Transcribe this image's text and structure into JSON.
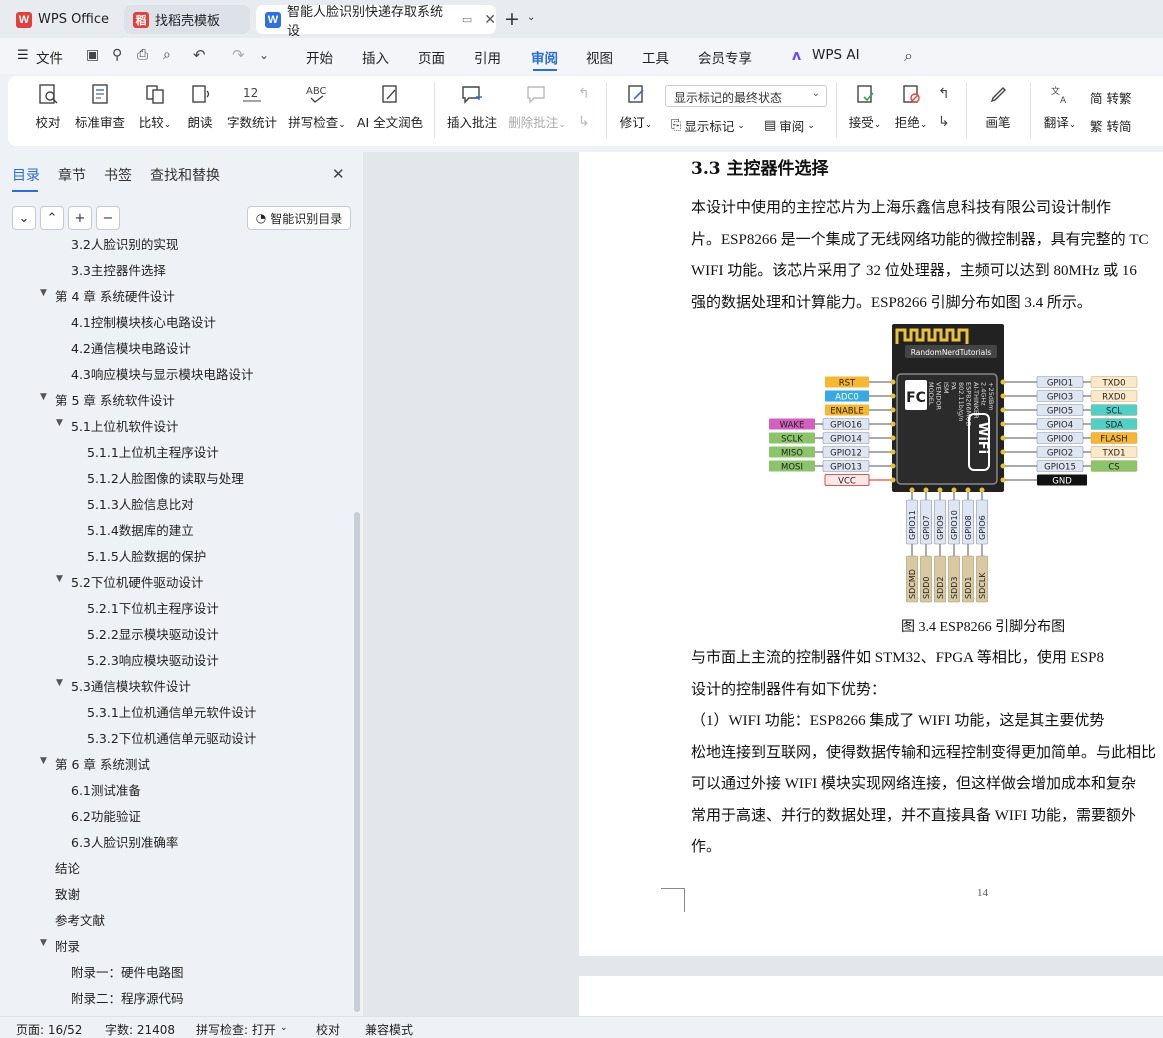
{
  "tabs": [
    {
      "label": "WPS Office",
      "icon": "W"
    },
    {
      "label": "找稻壳模板",
      "icon": "稻"
    },
    {
      "label": "智能人脸识别快递存取系统设",
      "icon": "W"
    }
  ],
  "menu": [
    "文件",
    "开始",
    "插入",
    "页面",
    "引用",
    "审阅",
    "视图",
    "工具",
    "会员专享",
    "WPS AI"
  ],
  "ribbon": {
    "buttons": [
      "校对",
      "标准审查",
      "比较",
      "朗读",
      "字数统计",
      "拼写检查",
      "AI 全文润色",
      "插入批注",
      "删除批注",
      "修订"
    ],
    "markup_select": "显示标记的最终状态",
    "show_markup": "显示标记",
    "review_pane": "审阅",
    "accept": "接受",
    "reject": "拒绝",
    "pen": "画笔",
    "translate": "翻译",
    "to_traditional": "简 转繁",
    "to_simplified": "繁 转简"
  },
  "nav": {
    "tabs": [
      "目录",
      "章节",
      "书签",
      "查找和替换"
    ],
    "smart_toc": "智能识别目录",
    "toc": [
      {
        "text": "3.2人脸识别的实现",
        "level": 2
      },
      {
        "text": "3.3主控器件选择",
        "level": 2
      },
      {
        "text": "第 4 章  系统硬件设计",
        "level": 1,
        "expanded": true
      },
      {
        "text": "4.1控制模块核心电路设计",
        "level": 2
      },
      {
        "text": "4.2通信模块电路设计",
        "level": 2
      },
      {
        "text": "4.3响应模块与显示模块电路设计",
        "level": 2
      },
      {
        "text": "第 5 章  系统软件设计",
        "level": 1,
        "expanded": true
      },
      {
        "text": "5.1上位机软件设计",
        "level": 2,
        "expanded": true
      },
      {
        "text": "5.1.1上位机主程序设计",
        "level": 3
      },
      {
        "text": "5.1.2人脸图像的读取与处理",
        "level": 3
      },
      {
        "text": "5.1.3人脸信息比对",
        "level": 3
      },
      {
        "text": "5.1.4数据库的建立",
        "level": 3
      },
      {
        "text": "5.1.5人脸数据的保护",
        "level": 3
      },
      {
        "text": "5.2下位机硬件驱动设计",
        "level": 2,
        "expanded": true
      },
      {
        "text": "5.2.1下位机主程序设计",
        "level": 3
      },
      {
        "text": "5.2.2显示模块驱动设计",
        "level": 3
      },
      {
        "text": "5.2.3响应模块驱动设计",
        "level": 3
      },
      {
        "text": "5.3通信模块软件设计",
        "level": 2,
        "expanded": true
      },
      {
        "text": "5.3.1上位机通信单元软件设计",
        "level": 3
      },
      {
        "text": "5.3.2下位机通信单元驱动设计",
        "level": 3
      },
      {
        "text": "第 6 章  系统测试",
        "level": 1,
        "expanded": true
      },
      {
        "text": "6.1测试准备",
        "level": 2
      },
      {
        "text": "6.2功能验证",
        "level": 2
      },
      {
        "text": "6.3人脸识别准确率",
        "level": 2
      },
      {
        "text": "结论",
        "level": 1
      },
      {
        "text": "致谢",
        "level": 1
      },
      {
        "text": "参考文献",
        "level": 1
      },
      {
        "text": "附录",
        "level": 1,
        "expanded": true
      },
      {
        "text": "附录一：硬件电路图",
        "level": 2
      },
      {
        "text": "附录二：程序源代码",
        "level": 2
      }
    ]
  },
  "doc": {
    "heading": "3.3  主控器件选择",
    "lines1": [
      "    本设计中使用的主控芯片为上海乐鑫信息科技有限公司设计制作",
      "片。ESP8266 是一个集成了无线网络功能的微控制器，具有完整的 TC",
      "WIFI 功能。该芯片采用了  32 位处理器，主频可以达到  80MHz 或 16",
      "强的数据处理和计算能力。ESP8266 引脚分布如图 3.4 所示。"
    ],
    "caption": "图 3.4 ESP8266 引脚分布图",
    "lines2": [
      "    与市面上主流的控制器件如  STM32、FPGA 等相比，使用  ESP8",
      "设计的控制器件有如下优势：",
      "    （1）WIFI 功能：ESP8266 集成了  WIFI 功能，这是其主要优势",
      "松地连接到互联网，使得数据传输和远程控制变得更加简单。与此相比",
      "可以通过外接  WIFI 模块实现网络连接，但这样做会增加成本和复杂",
      "常用于高速、并行的数据处理，并不直接具备  WIFI 功能，需要额外",
      "作。"
    ],
    "page_number": "14"
  },
  "figure": {
    "brand": "RandomNerdTutorials",
    "chip_text": [
      "MODEL",
      "VENDOR",
      "ISM",
      "PA",
      "802.11b/g/n",
      "ESP8266MOD",
      "AI-THINKER",
      "2.4GHz",
      "+25dBm"
    ],
    "wifi": "WiFi",
    "left_pins": [
      {
        "func": "RST",
        "gpio": "",
        "color": "#f6b731"
      },
      {
        "func": "ADC0",
        "gpio": "",
        "color": "#36a9e1"
      },
      {
        "func": "ENABLE",
        "gpio": "",
        "color": "#f6b731"
      },
      {
        "func": "WAKE",
        "gpio": "GPIO16",
        "color": "#d35fbf"
      },
      {
        "func": "SCLK",
        "gpio": "GPIO14",
        "color": "#8cc46b"
      },
      {
        "func": "MISO",
        "gpio": "GPIO12",
        "color": "#8cc46b"
      },
      {
        "func": "MOSI",
        "gpio": "GPIO13",
        "color": "#8cc46b"
      },
      {
        "func": "VCC",
        "gpio": "",
        "color": "#fde8e8"
      }
    ],
    "right_pins": [
      {
        "gpio": "GPIO1",
        "func": "TXD0",
        "color": "#fbe9c9"
      },
      {
        "gpio": "GPIO3",
        "func": "RXD0",
        "color": "#fbe9c9"
      },
      {
        "gpio": "GPIO5",
        "func": "SCL",
        "color": "#4fd0c8"
      },
      {
        "gpio": "GPIO4",
        "func": "SDA",
        "color": "#4fd0c8"
      },
      {
        "gpio": "GPIO0",
        "func": "FLASH",
        "color": "#f6b731"
      },
      {
        "gpio": "GPIO2",
        "func": "TXD1",
        "color": "#fbe9c9"
      },
      {
        "gpio": "GPIO15",
        "func": "CS",
        "color": "#8cc46b"
      },
      {
        "gpio": "",
        "func": "GND",
        "color": "#111111"
      }
    ],
    "bottom_pins": [
      {
        "gpio": "GPIO11",
        "func": "SDCMD"
      },
      {
        "gpio": "GPIO7",
        "func": "SDD0"
      },
      {
        "gpio": "GPIO9",
        "func": "SDD2"
      },
      {
        "gpio": "GPIO10",
        "func": "SDD3"
      },
      {
        "gpio": "GPIO8",
        "func": "SDD1"
      },
      {
        "gpio": "GPIO6",
        "func": "SDCLK"
      }
    ]
  },
  "status": {
    "page": "页面: 16/52",
    "words": "字数: 21408",
    "spell": "拼写检查: 打开",
    "proof": "校对",
    "compat": "兼容模式"
  }
}
